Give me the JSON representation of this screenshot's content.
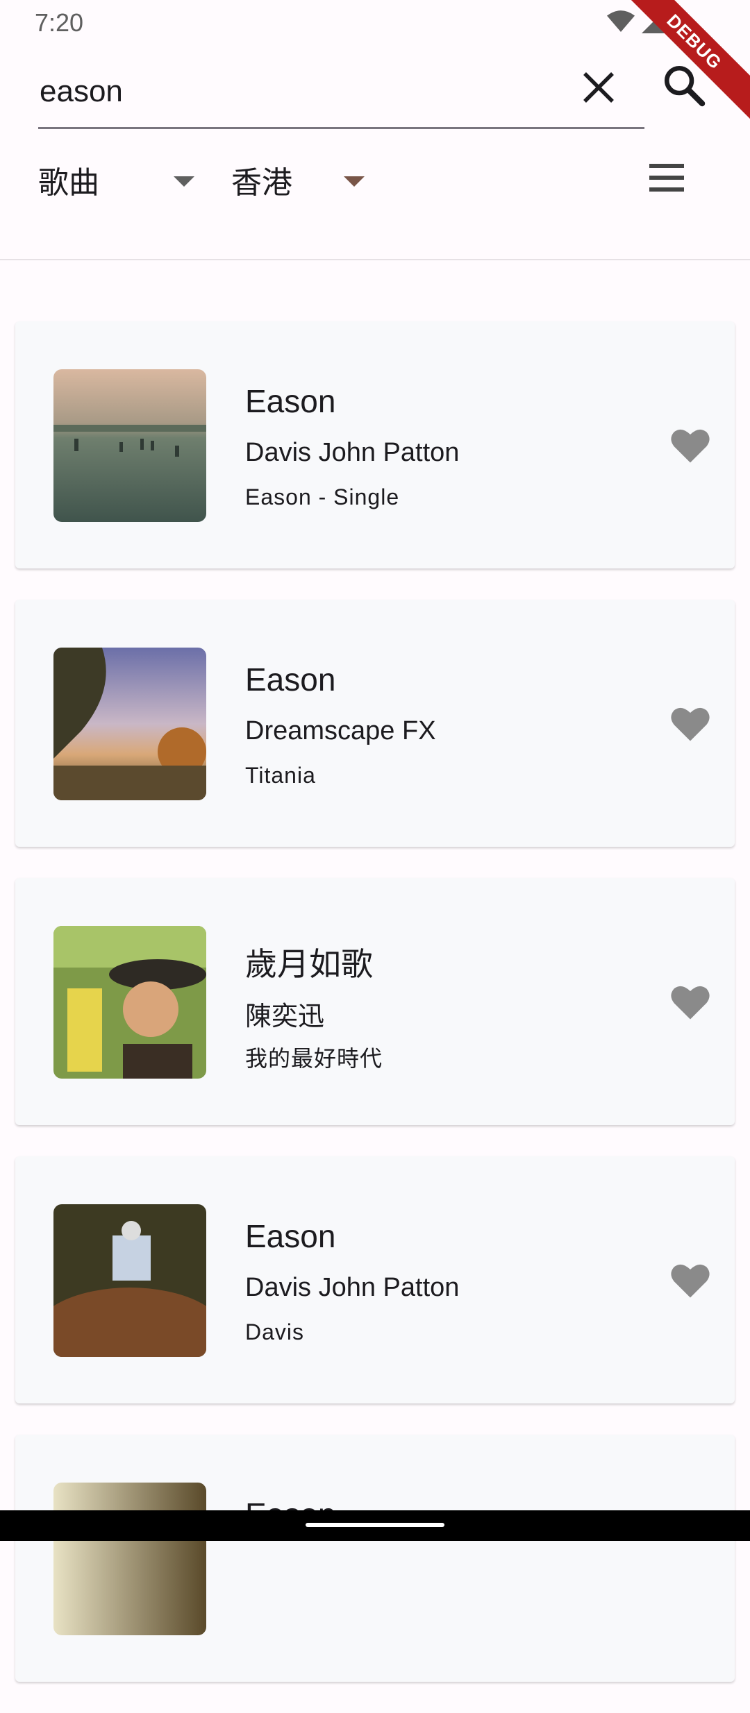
{
  "status": {
    "time": "7:20",
    "debug_banner": "DEBUG"
  },
  "search": {
    "value": "eason",
    "placeholder": ""
  },
  "filters": {
    "category": "歌曲",
    "region": "香港"
  },
  "icons": {
    "clear": "close-icon",
    "search": "search-icon",
    "menu": "menu-icon",
    "favorite": "heart-icon",
    "wifi": "wifi-icon",
    "signal": "signal-icon",
    "battery": "battery-icon"
  },
  "colors": {
    "favorite": "#8a8a8a",
    "card_bg": "#f8f9fb",
    "underline": "#79747e",
    "region_caret": "#795548"
  },
  "songs": [
    {
      "title": "Eason",
      "artist": "Davis John Patton",
      "album": "Eason - Single"
    },
    {
      "title": "Eason",
      "artist": "Dreamscape FX",
      "album": "Titania"
    },
    {
      "title": "歲月如歌",
      "artist": "陳奕迅",
      "album": "我的最好時代"
    },
    {
      "title": "Eason",
      "artist": "Davis John Patton",
      "album": "Davis"
    },
    {
      "title": "Eason",
      "artist": "",
      "album": ""
    }
  ]
}
